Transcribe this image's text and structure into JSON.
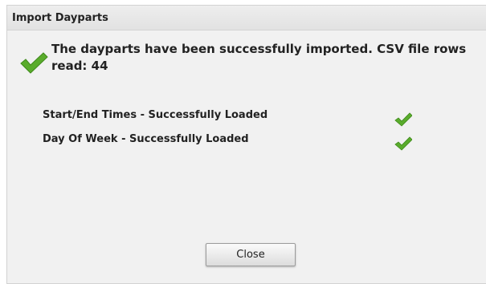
{
  "dialog": {
    "title": "Import Dayparts",
    "message": "The dayparts have been successfully imported. CSV file rows read: 44",
    "message_icon": "checkmark-icon",
    "statuses": [
      {
        "label": "Start/End Times - Successfully Loaded",
        "icon": "checkmark-icon"
      },
      {
        "label": "Day Of Week - Successfully Loaded",
        "icon": "checkmark-icon"
      }
    ],
    "close_label": "Close"
  },
  "colors": {
    "success": "#5aac2c",
    "dialog_bg": "#f1f1f1",
    "title_bg": "#e8e8e8"
  }
}
